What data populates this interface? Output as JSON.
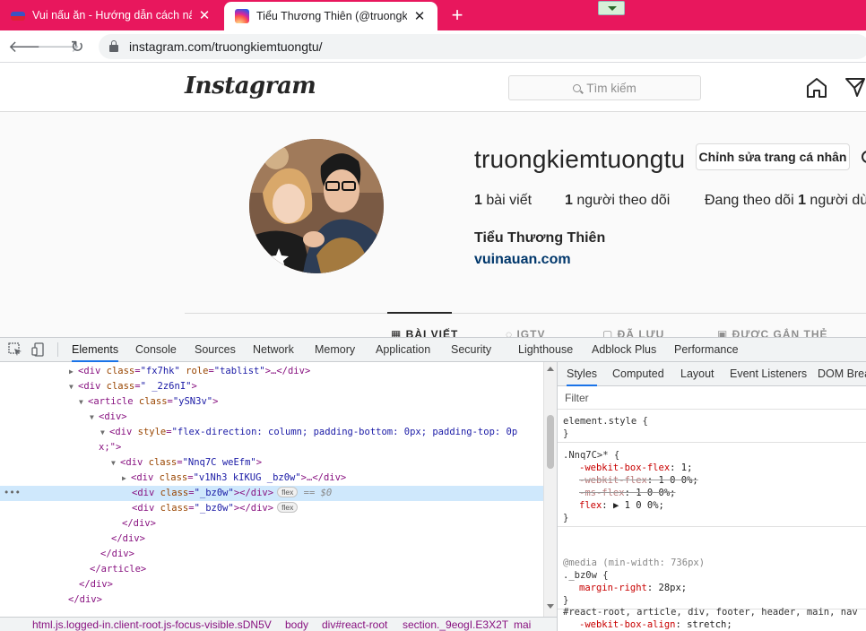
{
  "browser": {
    "tabs": [
      {
        "title": "Vui nấu ăn - Hướng dẫn cách nấu",
        "close": "✕"
      },
      {
        "title": "Tiểu Thương Thiên (@truongkiem",
        "close": "✕"
      }
    ],
    "new_tab": "+",
    "url": "instagram.com/truongkiemtuongtu/",
    "accent": "#e8175d"
  },
  "instagram": {
    "logo": "Instagram",
    "search_placeholder": "Tìm kiếm",
    "profile": {
      "username": "truongkiemtuongtu",
      "edit_button": "Chỉnh sửa trang cá nhân",
      "posts_count": "1",
      "posts_label": " bài viết",
      "followers_count": "1",
      "followers_label": " người theo dõi",
      "following_prefix": "Đang theo dõi ",
      "following_count": "1",
      "following_suffix": " người dù",
      "full_name": "Tiểu Thương Thiên",
      "website": "vuinauan.com"
    },
    "tabs": [
      "BÀI VIẾT",
      "IGTV",
      "ĐÃ LƯU",
      "ĐƯỢC GẮN THẺ"
    ]
  },
  "devtools": {
    "tabs": [
      "Elements",
      "Console",
      "Sources",
      "Network",
      "Memory",
      "Application",
      "Security",
      "Lighthouse",
      "Adblock Plus",
      "Performance"
    ],
    "dom": [
      {
        "tri": "▶",
        "open": "<div",
        "attrs": [
          [
            "class",
            "\"fx7hk\""
          ],
          [
            "role",
            "\"tablist\""
          ]
        ],
        "rest": ">…</div>"
      },
      {
        "tri": "▼",
        "open": "<div",
        "attrs": [
          [
            "class",
            "\" _2z6nI\""
          ]
        ],
        "rest": ">"
      },
      {
        "tri": "▼",
        "open": "<article",
        "attrs": [
          [
            "class",
            "\"ySN3v\""
          ]
        ],
        "rest": ">"
      },
      {
        "tri": "▼",
        "open": "<div",
        "attrs": [],
        "rest": ">"
      },
      {
        "tri": "▼",
        "open": "<div",
        "attrs": [
          [
            "style",
            "\"flex-direction: column; padding-bottom: 0px; padding-top: 0p"
          ]
        ],
        "rest": ""
      },
      {
        "tri": "",
        "open": "",
        "attrs": [],
        "rest": "",
        "text": "x;\">"
      },
      {
        "tri": "▼",
        "open": "<div",
        "attrs": [
          [
            "class",
            "\"Nnq7C weEfm\""
          ]
        ],
        "rest": ">"
      },
      {
        "tri": "▶",
        "open": "<div",
        "attrs": [
          [
            "class",
            "\"v1Nh3 kIKUG  _bz0w\""
          ]
        ],
        "rest": ">…</div>"
      },
      {
        "tri": "",
        "open": "<div",
        "attrs": [
          [
            "class",
            "\"_bz0w\""
          ]
        ],
        "rest": "></div>",
        "pill": "flex",
        "eq": "== $0"
      },
      {
        "tri": "",
        "open": "<div",
        "attrs": [
          [
            "class",
            "\"_bz0w\""
          ]
        ],
        "rest": "></div>",
        "pill": "flex"
      },
      {
        "tri": "",
        "open": "",
        "attrs": [],
        "rest": "</div>"
      },
      {
        "tri": "",
        "open": "",
        "attrs": [],
        "rest": "</div>"
      },
      {
        "tri": "",
        "open": "",
        "attrs": [],
        "rest": "</div>"
      },
      {
        "tri": "",
        "open": "",
        "attrs": [],
        "rest": "</article>"
      },
      {
        "tri": "",
        "open": "",
        "attrs": [],
        "rest": "</div>"
      },
      {
        "tri": "",
        "open": "",
        "attrs": [],
        "rest": "</div>"
      }
    ],
    "selected_row_marker": "•••",
    "styles_tabs": [
      "Styles",
      "Computed",
      "Layout",
      "Event Listeners",
      "DOM Brea"
    ],
    "filter_placeholder": "Filter",
    "rules": [
      {
        "lines": [
          "element.style {",
          "}"
        ]
      },
      {
        "lines": [
          ".Nnq7C>* {",
          "-webkit-box-flex: 1;",
          "-webkit-flex: 1 0 0%;",
          "-ms-flex: 1 0 0%;",
          "flex: ▶ 1 0 0%;",
          "}"
        ]
      },
      {
        "lines": [
          "@media (min-width: 736px)",
          "._bz0w {",
          "margin-right: 28px;",
          "}"
        ]
      },
      {
        "lines": [
          "#react-root, article, div, footer, header, main, nav",
          "-webkit-box-align: stretch;",
          "-webkit-align-items: stretch;",
          "-ms-flex-align: stretch;"
        ]
      }
    ],
    "breadcrumbs": [
      "html.js.logged-in.client-root.js-focus-visible.sDN5V",
      "body",
      "div#react-root",
      "section._9eogI.E3X2T",
      "mai"
    ]
  }
}
